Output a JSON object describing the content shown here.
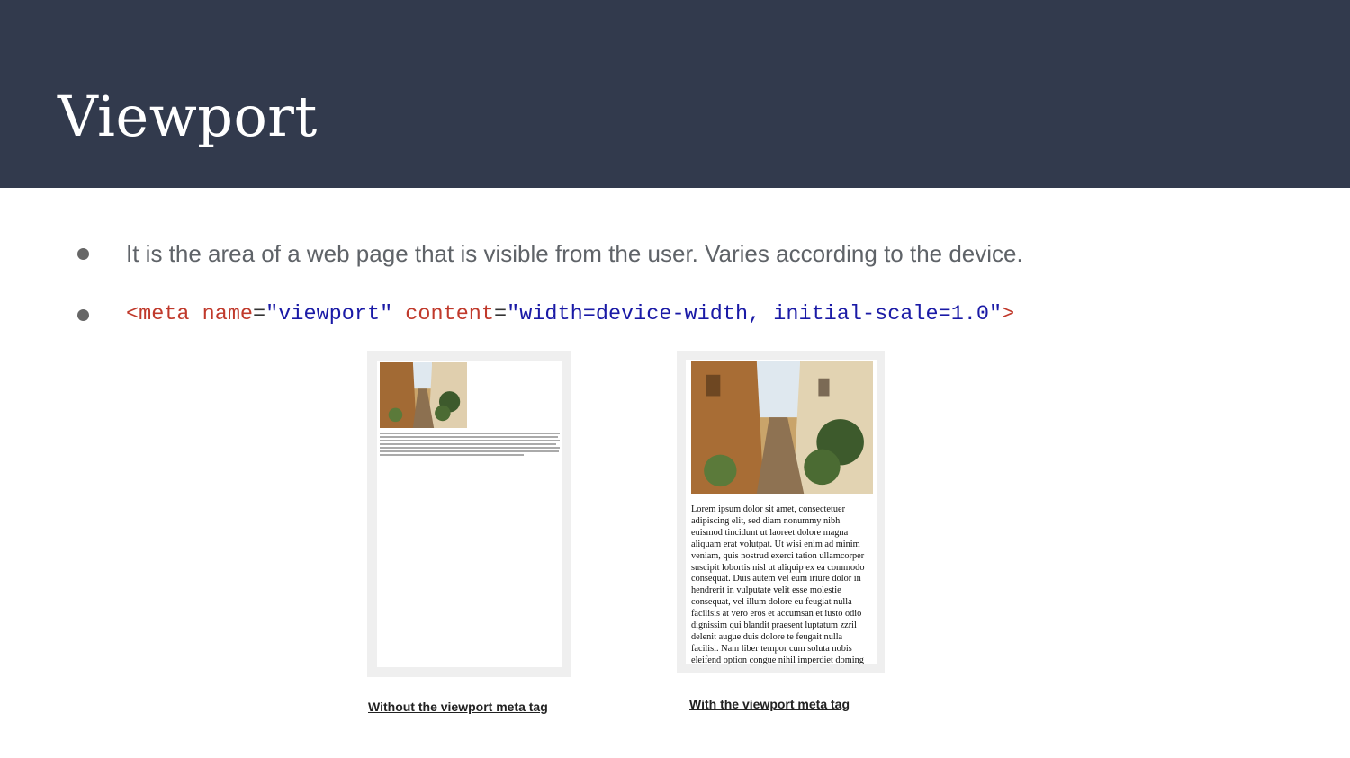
{
  "slide": {
    "title": "Viewport",
    "bullets": [
      {
        "text": "It is the area of a web page that is visible from the user. Varies according to the device."
      }
    ],
    "code": {
      "open": "<meta",
      "name_attr": "name",
      "eq": "=",
      "name_value": "\"viewport\"",
      "content_attr": "content",
      "content_value": "\"width=device-width, initial-scale=1.0\"",
      "close": ">"
    }
  },
  "figures": {
    "without": {
      "caption": "Without the viewport meta tag"
    },
    "with": {
      "caption": "With the viewport meta tag",
      "lorem": "Lorem ipsum dolor sit amet, consectetuer\nadipiscing elit, sed diam nonummy nibh\neuismod tincidunt ut laoreet dolore magna\naliquam erat volutpat. Ut wisi enim ad minim\nveniam, quis nostrud exerci tation ullamcorper\nsuscipit lobortis nisl ut aliquip ex ea commodo\nconsequat. Duis autem vel eum iriure dolor in\nhendrerit in vulputate velit esse molestie\nconsequat, vel illum dolore eu feugiat nulla\nfacilisis at vero eros et accumsan et iusto odio\ndignissim qui blandit praesent luptatum zzril\ndelenit augue duis dolore te feugait nulla\nfacilisi. Nam liber tempor cum soluta nobis\neleifend option congue nihil imperdiet doming"
    }
  },
  "colors": {
    "header_bg": "#323a4d",
    "title": "#ffffff",
    "bullet_text": "#5f6368",
    "code_tag": "#c0392b",
    "code_value": "#1a1aa6"
  }
}
